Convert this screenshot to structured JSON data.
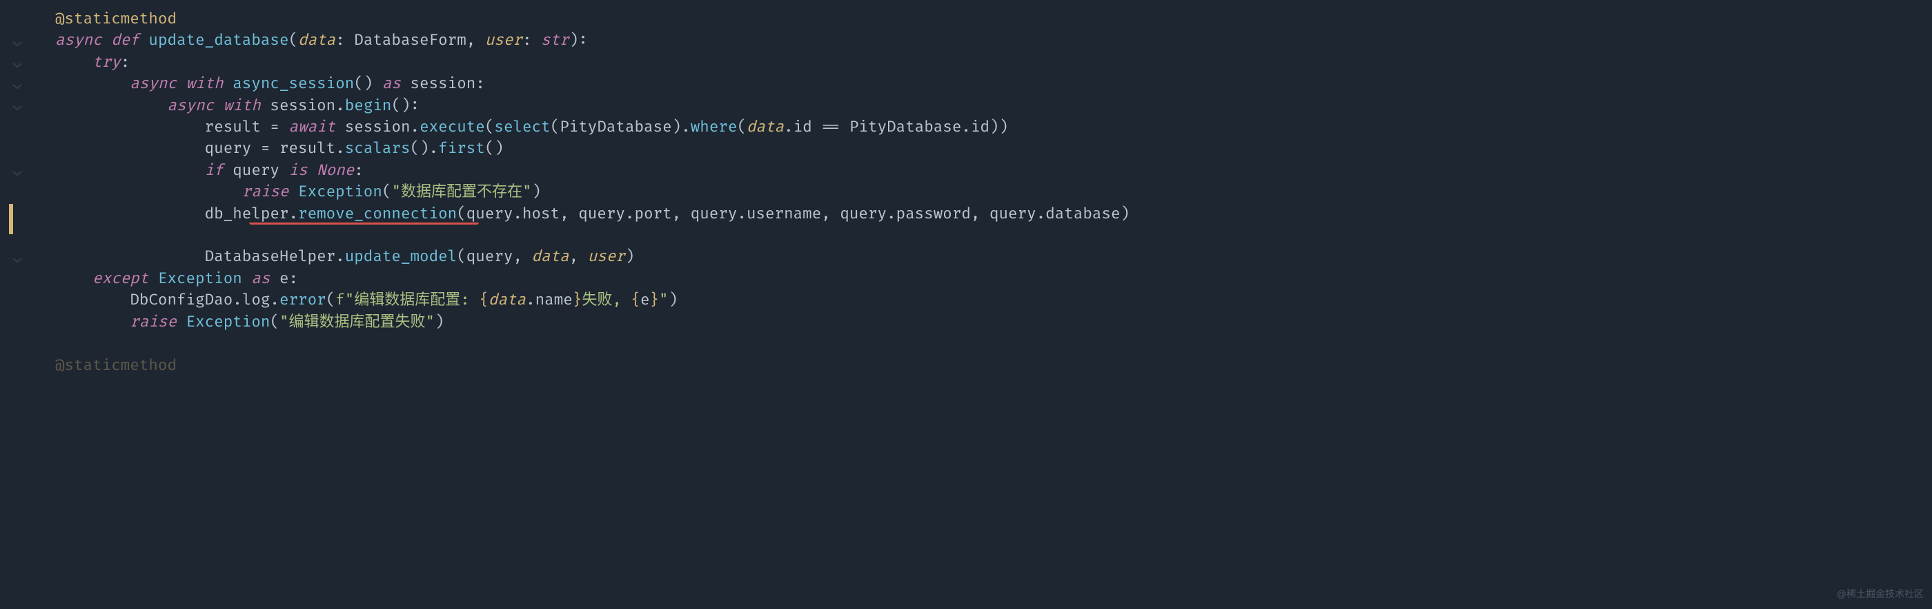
{
  "code": {
    "decorator": "@staticmethod",
    "async": "async",
    "def": "def",
    "func_name": "update_database",
    "param_data": "data",
    "type_DatabaseForm": "DatabaseForm",
    "param_user": "user",
    "type_str": "str",
    "try": "try",
    "with": "with",
    "async_session": "async_session",
    "as": "as",
    "session": "session",
    "begin": "begin",
    "result": "result",
    "await": "await",
    "execute": "execute",
    "select": "select",
    "PityDatabase": "PityDatabase",
    "where": "where",
    "id": "id",
    "eqeq": "==",
    "query": "query",
    "scalars": "scalars",
    "first": "first",
    "if": "if",
    "is": "is",
    "None": "None",
    "raise": "raise",
    "Exception": "Exception",
    "str_db_not_exist": "\"数据库配置不存在\"",
    "db_helper": "db_helper",
    "remove_connection": "remove_connection",
    "host": "host",
    "port": "port",
    "username": "username",
    "password": "password",
    "database": "database",
    "DatabaseHelper": "DatabaseHelper",
    "update_model": "update_model",
    "except": "except",
    "e": "e",
    "DbConfigDao": "DbConfigDao",
    "log": "log",
    "error": "error",
    "fstr_prefix": "f\"编辑数据库配置: ",
    "name": "name",
    "fstr_mid": "失败, ",
    "fstr_end": "\"",
    "str_edit_fail": "\"编辑数据库配置失败\"",
    "decorator_faded": "@staticmethod"
  },
  "watermark": "@稀土掘金技术社区"
}
